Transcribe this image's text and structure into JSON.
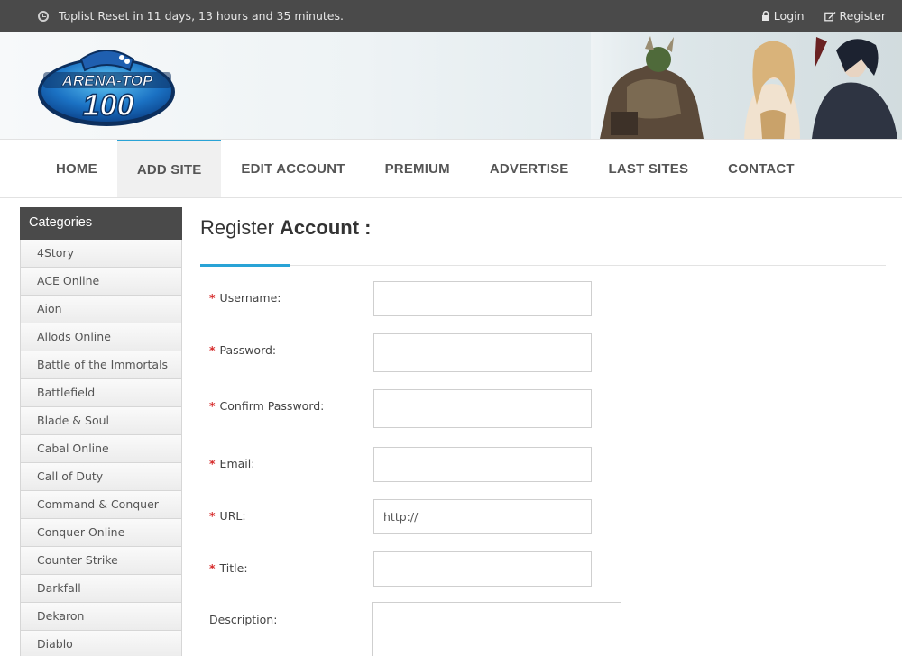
{
  "topbar": {
    "reset_text": "Toplist Reset in 11 days, 13 hours and 35 minutes.",
    "login_label": "Login",
    "register_label": "Register"
  },
  "header": {
    "logo_text_top": "ARENA-TOP",
    "logo_text_bottom": "100"
  },
  "nav": {
    "items": [
      "HOME",
      "ADD SITE",
      "EDIT ACCOUNT",
      "PREMIUM",
      "ADVERTISE",
      "LAST SITES",
      "CONTACT"
    ],
    "active": "ADD SITE"
  },
  "sidebar": {
    "title": "Categories",
    "items": [
      "4Story",
      "ACE Online",
      "Aion",
      "Allods Online",
      "Battle of the Immortals",
      "Battlefield",
      "Blade & Soul",
      "Cabal Online",
      "Call of Duty",
      "Command & Conquer",
      "Conquer Online",
      "Counter Strike",
      "Darkfall",
      "Dekaron",
      "Diablo"
    ]
  },
  "form": {
    "title_light": "Register",
    "title_bold": "Account :",
    "required_mark": "*",
    "fields": {
      "username": {
        "label": "Username:",
        "value": ""
      },
      "password": {
        "label": "Password:",
        "value": ""
      },
      "confirm": {
        "label": "Confirm Password:",
        "value": ""
      },
      "email": {
        "label": "Email:",
        "value": ""
      },
      "url": {
        "label": "URL:",
        "value": "http://"
      },
      "title": {
        "label": "Title:",
        "value": ""
      },
      "description": {
        "label": "Description:",
        "value": ""
      }
    }
  },
  "colors": {
    "topbar_bg": "#4a4a4a",
    "accent": "#29a3d6",
    "required": "#d62b2b"
  }
}
